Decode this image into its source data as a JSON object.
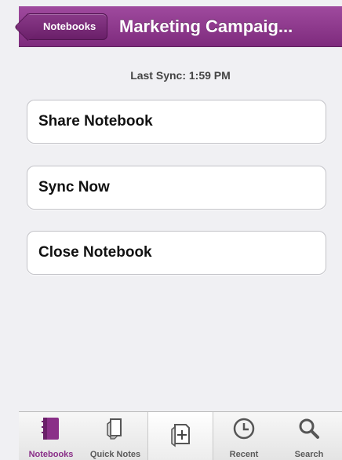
{
  "navbar": {
    "back_label": "Notebooks",
    "title": "Marketing Campaig..."
  },
  "sync": {
    "status": "Last Sync: 1:59 PM"
  },
  "actions": [
    {
      "label": "Share Notebook"
    },
    {
      "label": "Sync Now"
    },
    {
      "label": "Close Notebook"
    }
  ],
  "tabbar": {
    "items": [
      {
        "label": "Notebooks",
        "icon": "notebook-icon"
      },
      {
        "label": "Quick Notes",
        "icon": "quick-notes-icon"
      },
      {
        "label": "",
        "icon": "new-page-icon"
      },
      {
        "label": "Recent",
        "icon": "clock-icon"
      },
      {
        "label": "Search",
        "icon": "search-icon"
      }
    ]
  },
  "colors": {
    "accent": "#8a2f88",
    "navbar": "#8e3a8d",
    "background": "#f0f0f3"
  }
}
